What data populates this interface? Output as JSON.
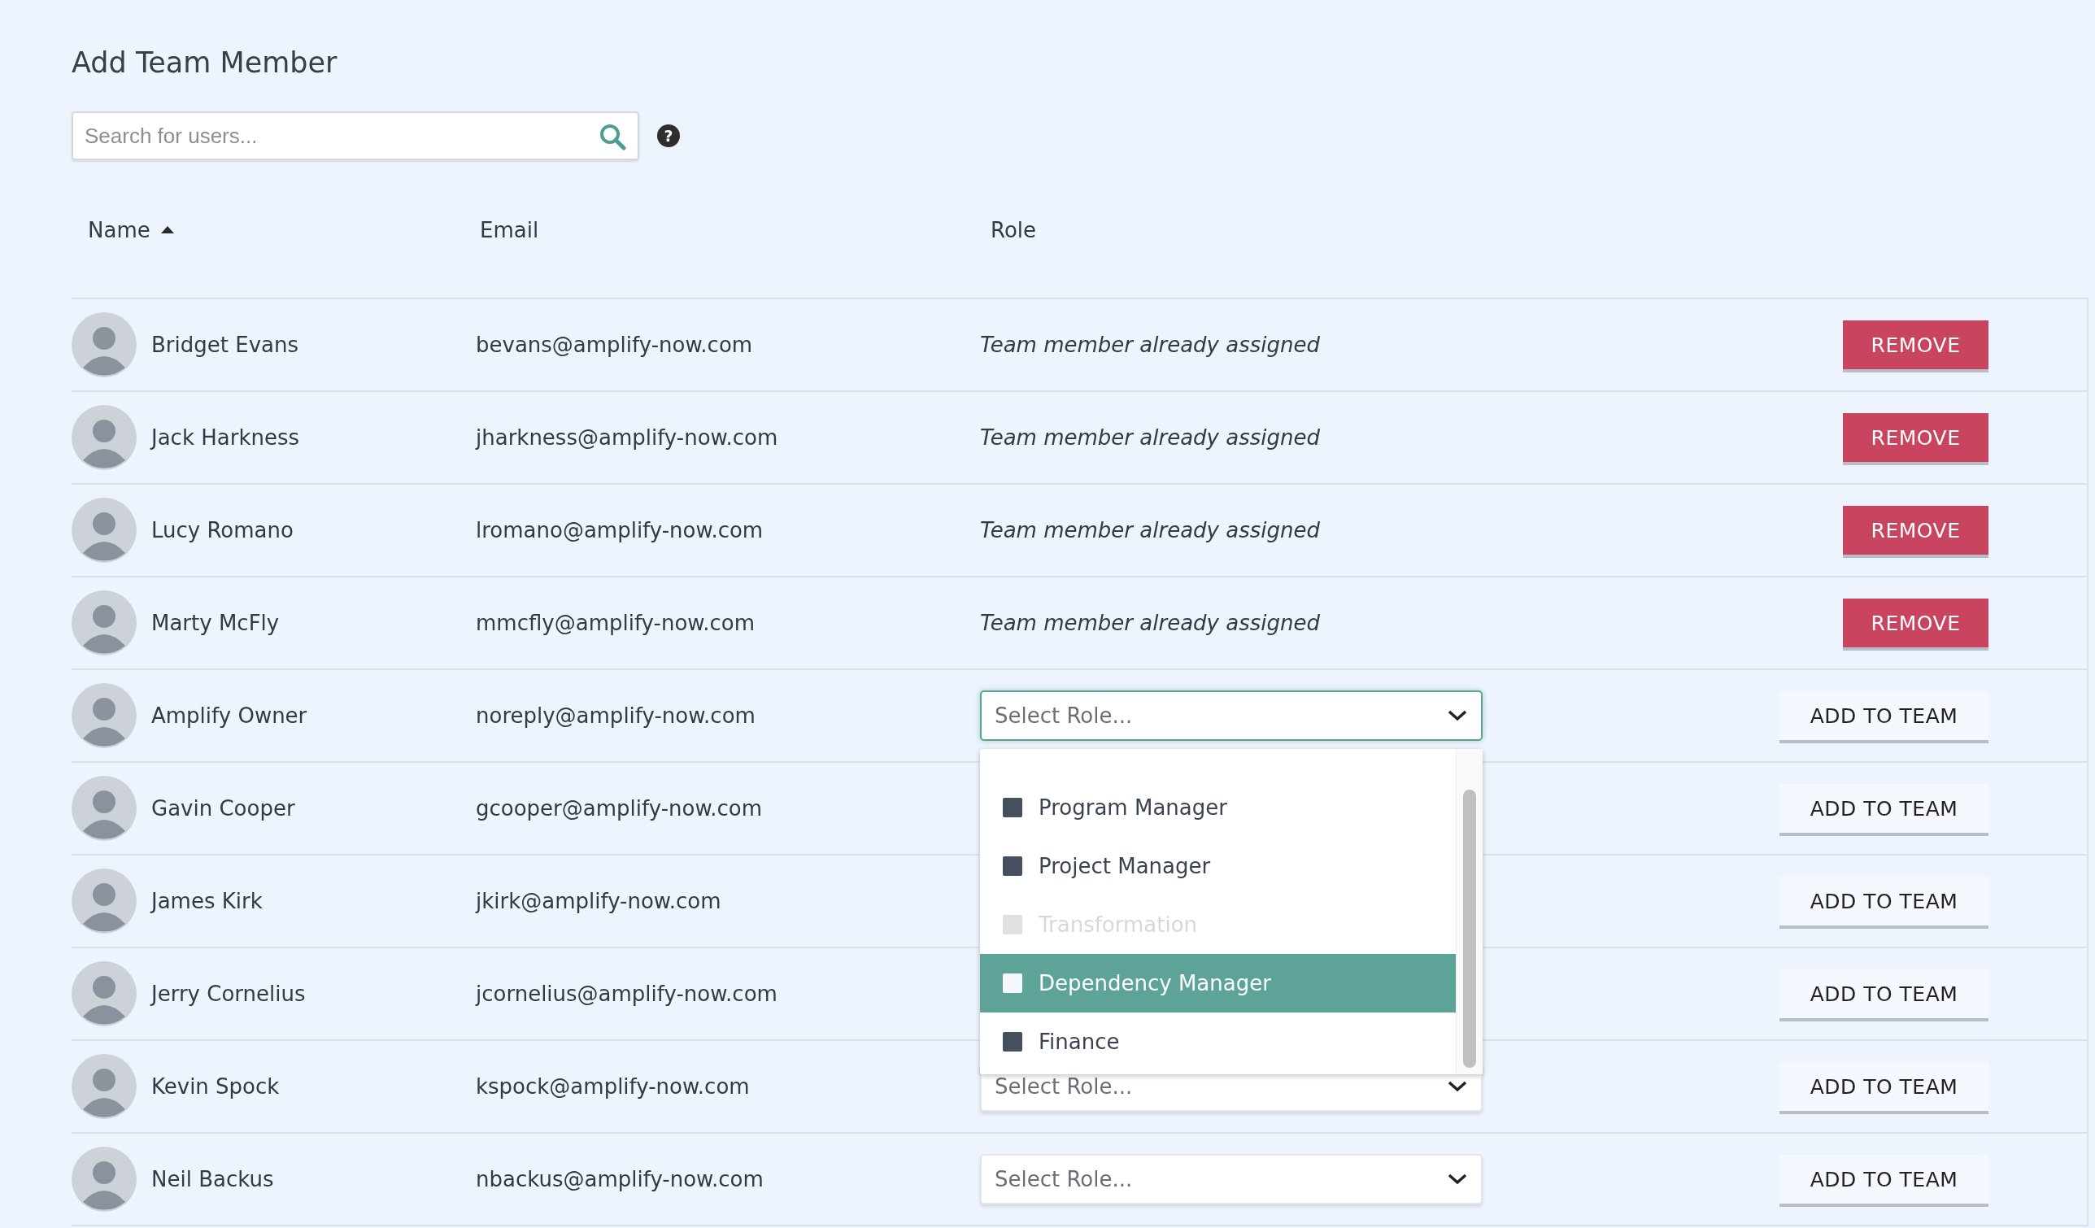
{
  "title": "Add Team Member",
  "search": {
    "placeholder": "Search for users..."
  },
  "help_icon": "?",
  "columns": [
    {
      "label": "Name",
      "sorted": true
    },
    {
      "label": "Email"
    },
    {
      "label": "Role"
    }
  ],
  "rows": [
    {
      "name": "Bridget Evans",
      "email": "bevans@amplify-now.com",
      "role": {
        "kind": "note",
        "text": "Team member already assigned"
      },
      "action": {
        "kind": "remove",
        "label": "REMOVE"
      }
    },
    {
      "name": "Jack Harkness",
      "email": "jharkness@amplify-now.com",
      "role": {
        "kind": "note",
        "text": "Team member already assigned"
      },
      "action": {
        "kind": "remove",
        "label": "REMOVE"
      }
    },
    {
      "name": "Lucy Romano",
      "email": "lromano@amplify-now.com",
      "role": {
        "kind": "note",
        "text": "Team member already assigned"
      },
      "action": {
        "kind": "remove",
        "label": "REMOVE"
      }
    },
    {
      "name": "Marty McFly",
      "email": "mmcfly@amplify-now.com",
      "role": {
        "kind": "note",
        "text": "Team member already assigned"
      },
      "action": {
        "kind": "remove",
        "label": "REMOVE"
      }
    },
    {
      "name": "Amplify Owner",
      "email": "noreply@amplify-now.com",
      "role": {
        "kind": "select",
        "value": "Select Role...",
        "open": true,
        "options": [
          {
            "label": "Program Manager",
            "disabled": false,
            "selected": false
          },
          {
            "label": "Project Manager",
            "disabled": false,
            "selected": false
          },
          {
            "label": "Transformation",
            "disabled": true,
            "selected": false
          },
          {
            "label": "Dependency Manager",
            "disabled": false,
            "selected": true
          },
          {
            "label": "Finance",
            "disabled": false,
            "selected": false
          }
        ]
      },
      "action": {
        "kind": "add",
        "label": "ADD TO TEAM"
      }
    },
    {
      "name": "Gavin Cooper",
      "email": "gcooper@amplify-now.com",
      "action": {
        "kind": "add",
        "label": "ADD TO TEAM"
      }
    },
    {
      "name": "James Kirk",
      "email": "jkirk@amplify-now.com",
      "action": {
        "kind": "add",
        "label": "ADD TO TEAM"
      }
    },
    {
      "name": "Jerry Cornelius",
      "email": "jcornelius@amplify-now.com",
      "action": {
        "kind": "add",
        "label": "ADD TO TEAM"
      }
    },
    {
      "name": "Kevin Spock",
      "email": "kspock@amplify-now.com",
      "role": {
        "kind": "select",
        "value": "Select Role...",
        "open": false
      },
      "action": {
        "kind": "add",
        "label": "ADD TO TEAM"
      }
    },
    {
      "name": "Neil Backus",
      "email": "nbackus@amplify-now.com",
      "role": {
        "kind": "select",
        "value": "Select Role...",
        "open": false
      },
      "action": {
        "kind": "add",
        "label": "ADD TO TEAM"
      }
    }
  ]
}
